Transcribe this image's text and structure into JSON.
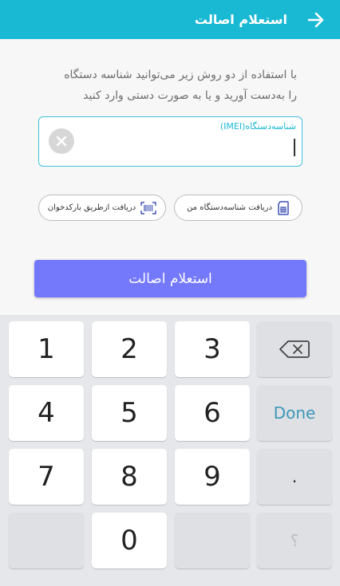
{
  "appbar": {
    "title": "استعلام اصالت",
    "back_icon": "arrow-right-icon",
    "bg_color": "#19b8d3"
  },
  "description": {
    "line1": "با استفاده از دو روش زیر می‌توانید شناسه دستگاه",
    "line2": "را به‌دست آورید و یا به صورت دستی وارد کنید"
  },
  "imei_field": {
    "label": "شناسه‌دستگاه(IMEI)",
    "value": "",
    "clear_icon": "close-icon",
    "accent": "#3fc2d8"
  },
  "actions": {
    "get_device_id": {
      "label": "دریافت شناسه‌دستگاه من",
      "icon": "sim-card-icon"
    },
    "scan_barcode": {
      "label": "دریافت ازطریق بارکدخوان",
      "icon": "barcode-scanner-icon"
    }
  },
  "submit": {
    "label": "استعلام اصالت",
    "color": "#7478fb"
  },
  "keyboard": {
    "keys": [
      "1",
      "2",
      "3",
      "4",
      "5",
      "6",
      "7",
      "8",
      "9",
      "0"
    ],
    "backspace_icon": "backspace-icon",
    "done_label": "Done",
    "dot_label": ".",
    "question_label": "؟"
  }
}
